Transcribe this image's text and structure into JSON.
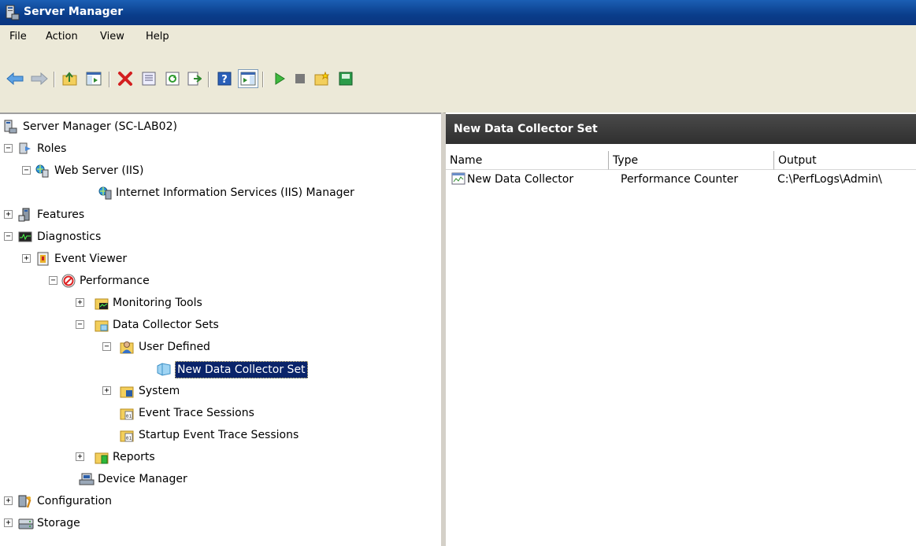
{
  "window": {
    "title": "Server Manager"
  },
  "menu": {
    "items": [
      "File",
      "Action",
      "View",
      "Help"
    ]
  },
  "toolbar": {
    "buttons": [
      "back-icon",
      "forward-icon",
      "up-folder-icon",
      "show-hide-console-tree-icon",
      "delete-icon",
      "properties-icon",
      "refresh-icon",
      "export-list-icon",
      "help-icon",
      "show-hide-action-pane-icon",
      "start-icon",
      "stop-icon",
      "new-icon",
      "save-template-icon"
    ]
  },
  "tree": {
    "root": "Server Manager (SC-LAB02)",
    "roles": "Roles",
    "web_server": "Web Server (IIS)",
    "iis_manager": "Internet Information Services (IIS) Manager",
    "features": "Features",
    "diagnostics": "Diagnostics",
    "event_viewer": "Event Viewer",
    "performance": "Performance",
    "monitoring_tools": "Monitoring Tools",
    "data_collector_sets": "Data Collector Sets",
    "user_defined": "User Defined",
    "new_dcs": "New Data Collector Set",
    "system": "System",
    "event_trace": "Event Trace Sessions",
    "startup_event_trace": "Startup Event Trace Sessions",
    "reports": "Reports",
    "device_manager": "Device Manager",
    "configuration": "Configuration",
    "storage": "Storage"
  },
  "detail": {
    "header": "New Data Collector Set",
    "columns": [
      "Name",
      "Type",
      "Output"
    ],
    "rows": [
      {
        "name": "New Data Collector",
        "type": "Performance Counter",
        "output": "C:\\PerfLogs\\Admin\\"
      }
    ]
  },
  "colors": {
    "selection": "#0a246a",
    "titlebar": "#0a3d8a",
    "header": "#2f2f2f"
  }
}
